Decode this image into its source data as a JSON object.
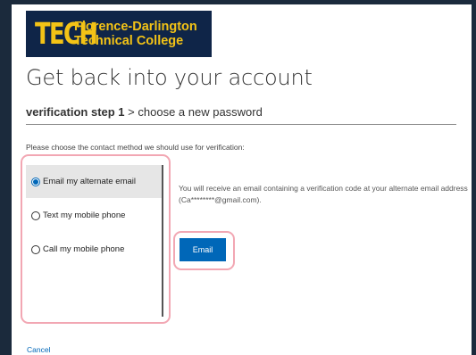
{
  "logo": {
    "mark": "TECH",
    "line1": "Florence-Darlington",
    "line2": "Technical College",
    "colors": {
      "background": "#0f2548",
      "text": "#f3c316"
    }
  },
  "page": {
    "title": "Get back into your account",
    "steps": {
      "current": "verification step 1",
      "separator": " > ",
      "next": "choose a new password"
    },
    "instruction": "Please choose the contact method we should use for verification:"
  },
  "methods": [
    {
      "label": "Email my alternate email",
      "selected": true
    },
    {
      "label": "Text my mobile phone",
      "selected": false
    },
    {
      "label": "Call my mobile phone",
      "selected": false
    }
  ],
  "detail": {
    "message": "You will receive an email containing a verification code at your alternate email address (Ca********@gmail.com).",
    "button_label": "Email"
  },
  "footer": {
    "cancel_label": "Cancel"
  },
  "colors": {
    "accent": "#0067b8",
    "highlight": "#f2a7b3",
    "frame": "#1b2a3c"
  }
}
